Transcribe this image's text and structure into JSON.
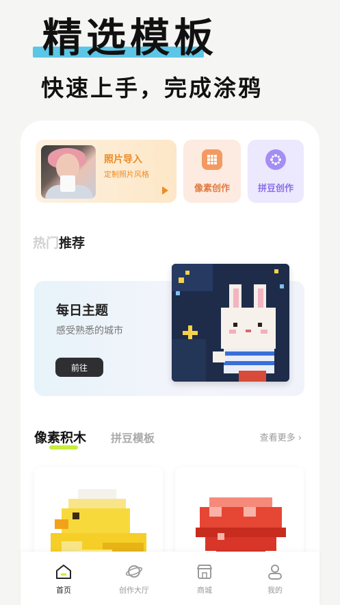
{
  "hero": {
    "title": "精选模板",
    "subtitle": "快速上手，完成涂鸦",
    "accent": "#5cc6e6"
  },
  "quick_actions": {
    "photo_import": {
      "title": "照片导入",
      "subtitle": "定制照片风格"
    },
    "pixel_create": {
      "label": "像素创作"
    },
    "bean_create": {
      "label": "拼豆创作"
    }
  },
  "hot": {
    "prefix": "热门",
    "title": "推荐"
  },
  "daily_theme": {
    "title": "每日主题",
    "subtitle": "感受熟悉的城市",
    "button": "前往"
  },
  "tabs": {
    "active": "像素积木",
    "inactive": "拼豆模板",
    "more": "查看更多"
  },
  "nav": [
    {
      "label": "首页",
      "icon": "home-icon"
    },
    {
      "label": "创作大厅",
      "icon": "planet-icon"
    },
    {
      "label": "商城",
      "icon": "shop-icon"
    },
    {
      "label": "我的",
      "icon": "user-icon"
    }
  ]
}
